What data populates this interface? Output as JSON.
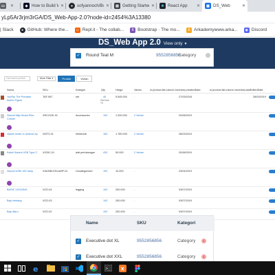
{
  "browser": {
    "tabs": [
      {
        "title": "",
        "icon": "document-icon",
        "color": "#5f6368"
      },
      {
        "title": "How to Build Web",
        "icon": "freecodecamp-icon",
        "color": "#0a0a23"
      },
      {
        "title": "sofyannoch/Bookf",
        "icon": "github-icon",
        "color": "#24292e"
      },
      {
        "title": "Getting Started –",
        "icon": "docs-icon",
        "color": "#3c4043"
      },
      {
        "title": "React App",
        "icon": "react-icon",
        "color": "#61dafb"
      },
      {
        "title": "DS_Web",
        "icon": "appsheet-icon",
        "color": "#1a73e8",
        "active": true
      }
    ],
    "url": "yLp5Ar3rjm3rGA/DS_Web-App-2.0?node-id=2454%3A13380",
    "bookmarks": [
      {
        "label": "| Slack",
        "icon": "slack-icon",
        "color": "#4a154b"
      },
      {
        "label": "GitHub: Where the...",
        "icon": "github-icon",
        "color": "#24292e"
      },
      {
        "label": "Repl.it - The collab...",
        "icon": "replit-icon",
        "color": "#f26207"
      },
      {
        "label": "Bootstrap · The mo...",
        "icon": "bootstrap-icon",
        "color": "#7952b3"
      },
      {
        "label": "Arkademywww.arka...",
        "icon": "arkademy-icon",
        "color": "#f5a623"
      },
      {
        "label": "Discord",
        "icon": "discord-icon",
        "color": "#5865f2"
      }
    ]
  },
  "app": {
    "title": "DS_Web App 2.0",
    "view_mode": "View only",
    "top_item": {
      "name": "Round Teal M",
      "sku": "9552856856",
      "category": "Category"
    }
  },
  "toolbar": {
    "search_placeholder": "Cari nama produk",
    "filter_label": "More Filter",
    "produk_label": "Produk",
    "varian_label": "Varian"
  },
  "table": {
    "headers": {
      "name": "Nama",
      "sku": "SKU",
      "kategori": "Kategori",
      "qty": "Qty",
      "harga": "Harga",
      "varian": "Varian",
      "created": "ui.product.list.column.inventory.createdDate",
      "lastedited": "ui.product.list.column.inventory.lastEditedDate"
    },
    "rows": [
      {
        "name": "YouRip The Predator Action Figure",
        "sku": "TAF-967",
        "kategori": "set",
        "qty": "45",
        "qty_sub": "Diterima: 78",
        "harga": "5.545.000",
        "varian": "-",
        "created": "27/03/2018",
        "lastedited": "28/03/2019",
        "thumb": "#a0522d",
        "badge": true
      },
      {
        "name": "Xiaomi Mija Smart Rice Cooker",
        "sku": "XRCOOK-01",
        "kategori": "Accessories",
        "qty": "100",
        "qty_sub": "",
        "harga": "1.200.000",
        "varian": "2 Varian",
        "created": "20/08/2019",
        "lastedited": "",
        "thumb": "#cccccc",
        "badge": true
      },
      {
        "name": "xiaomi smart rc android 4p",
        "sku": "XMTV-01",
        "kategori": "elektronik",
        "qty": "160",
        "qty_sub": "",
        "harga": "1.780.000",
        "varian": "2 Varian",
        "created": "28/03/2019",
        "lastedited": "",
        "thumb": "#d32f2f",
        "badge": true
      },
      {
        "name": "Kabel Xiaomi USB Type C",
        "sku": "XICBC-01",
        "kategori": "alat perlukangan",
        "qty": "430",
        "qty_sub": "",
        "harga": "50.000",
        "varian": "2 Varian",
        "created": "20/08/2019",
        "lastedited": "",
        "thumb": "#888888",
        "badge": true
      },
      {
        "name": "Xiaomi USB LED lamp",
        "sku": "XIAOMILEDLAMP-01",
        "kategori": "Uncategorized",
        "qty": "100",
        "qty_sub": "",
        "harga": "10.000",
        "varian": "-",
        "created": "23/04/2019",
        "lastedited": "",
        "thumb": "#e0e0e0",
        "badge": true
      },
      {
        "name": "BASIC LEGGING",
        "sku": "XCD-04",
        "kategori": "legging",
        "qty": "100",
        "qty_sub": "",
        "harga": "200.000",
        "varian": "-",
        "created": "03/07/2019",
        "lastedited": "",
        "thumb": "",
        "badge": false
      },
      {
        "name": "Baju terbang",
        "sku": "XCD-03",
        "kategori": "",
        "qty": "100",
        "qty_sub": "",
        "harga": "250.000",
        "varian": "-",
        "created": "03/07/2019",
        "lastedited": "",
        "thumb": "",
        "badge": false
      },
      {
        "name": "Baju Baru",
        "sku": "XCD-02",
        "kategori": "",
        "qty": "100",
        "qty_sub": "",
        "harga": "200.000",
        "varian": "-",
        "created": "03/07/2019",
        "lastedited": "",
        "thumb": "",
        "badge": false
      }
    ]
  },
  "bottom_card": {
    "headers": {
      "name": "Name",
      "sku": "SKU",
      "category": "Kategori"
    },
    "rows": [
      {
        "name": "Executive dot XL",
        "sku": "9552856856",
        "category": "Category"
      },
      {
        "name": "Executive dot XXL",
        "sku": "9552856856",
        "category": "Category"
      }
    ]
  },
  "colors": {
    "header_navy": "#1f3a60",
    "accent_blue": "#1f73b7",
    "link_blue": "#2a7ccf",
    "badge_purple": "#8e44ad"
  }
}
